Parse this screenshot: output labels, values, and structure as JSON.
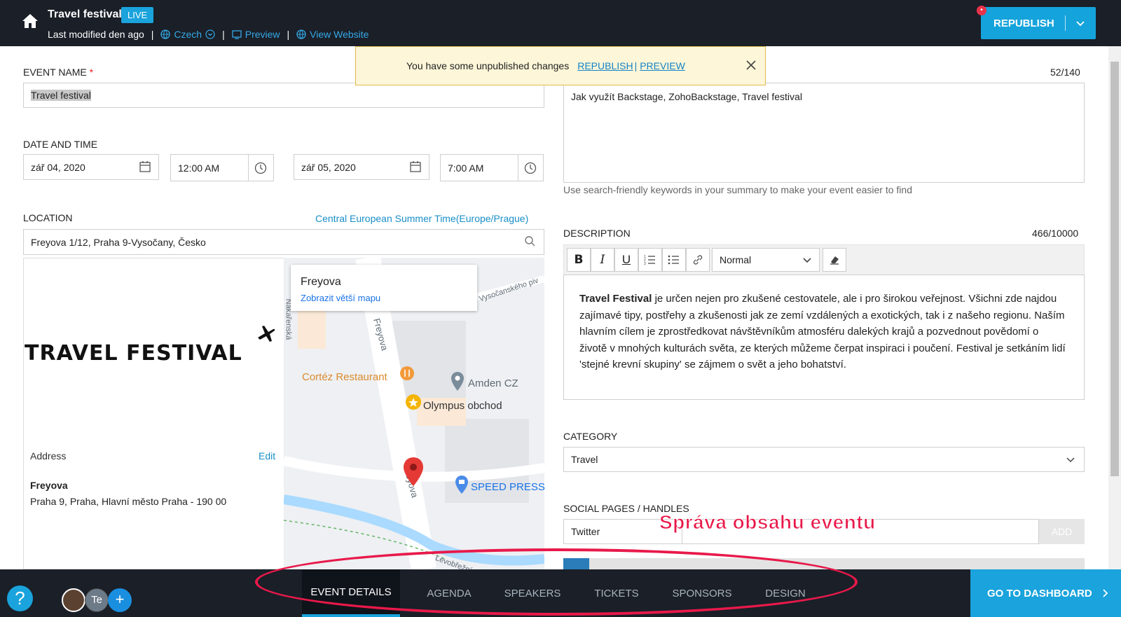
{
  "header": {
    "title": "Travel festival",
    "live_badge": "LIVE",
    "last_modified": "Last modified den ago",
    "language": "Czech",
    "preview": "Preview",
    "view_website": "View Website",
    "republish": "REPUBLISH",
    "notify_dot": "•"
  },
  "toast": {
    "message": "You have some unpublished changes",
    "republish_link": "REPUBLISH ",
    "separator": "|",
    "preview_link": "PREVIEW"
  },
  "event_name": {
    "label": "EVENT NAME",
    "required": "*",
    "value": "Travel festival"
  },
  "date_time": {
    "label": "DATE AND TIME",
    "start_date": "zář 04, 2020",
    "start_time": "12:00 AM",
    "end_date": "zář 05, 2020",
    "end_time": "7:00 AM"
  },
  "location": {
    "label": "LOCATION",
    "timezone": "Central European Summer Time(Europe/Prague)",
    "search_value": "Freyova 1/12, Praha 9-Vysočany, Česko",
    "logo_text": "TRAVEL FESTIVAL",
    "address_label": "Address",
    "edit": "Edit",
    "address_name": "Freyova",
    "address_line": "Praha 9, Praha, Hlavní město Praha - 190 00"
  },
  "map": {
    "place_name": "Freyova",
    "larger_map": "Zobrazit větší mapu",
    "labels": [
      "Cortéz Restaurant",
      "Amden CZ",
      "Olympus obchod",
      "SPEED PRESS",
      "Freyova",
      "Freyova",
      "Vysočanského piv",
      "Nákařenská",
      "Levobřežní"
    ]
  },
  "keywords": {
    "count": "52/140",
    "value": "Jak využít Backstage, ZohoBackstage, Travel festival",
    "hint": "Use search-friendly keywords in your summary to make your event easier to find"
  },
  "description": {
    "label": "DESCRIPTION",
    "count": "466/10000",
    "format_select": "Normal",
    "bold_lead": "Travel Festival",
    "body": " je určen nejen pro zkušené cestovatele, ale i pro širokou veřejnost. Všichni zde najdou zajímavé tipy, postřehy a zkušenosti jak ze zemí vzdálených a exotických, tak i z našeho regionu. Naším hlavním cílem je zprostředkovat návštěvníkům atmosféru dalekých krajů a pozvednout povědomí o životě v mnohých kulturách světa, ze kterých můžeme čerpat inspiraci i poučení. Festival je setkáním lidí 'stejné krevní skupiny' se zájmem o svět a jeho bohatství."
  },
  "category": {
    "label": "CATEGORY",
    "value": "Travel"
  },
  "social": {
    "label": "SOCIAL PAGES / HANDLES",
    "platform": "Twitter",
    "add": "ADD"
  },
  "annotation": "Správa obsahu eventu",
  "bottom": {
    "help": "?",
    "avatar_initials": "Te",
    "add": "+",
    "tabs": [
      "EVENT DETAILS",
      "AGENDA",
      "SPEAKERS",
      "TICKETS",
      "SPONSORS",
      "DESIGN"
    ],
    "dashboard": "GO TO DASHBOARD"
  },
  "colors": {
    "accent": "#1aa3dc",
    "dark": "#1a1f28",
    "annotation": "#e8194a"
  }
}
